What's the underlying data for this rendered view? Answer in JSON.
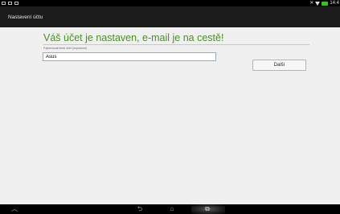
{
  "status_bar": {
    "time": "14:4"
  },
  "action_bar": {
    "title": "Nastavení účtu"
  },
  "form": {
    "headline": "Váš účet je nastaven, e-mail je na cestě!",
    "name_label": "Pojmenovat tento účet (nepovinné)",
    "name_value": "Asus",
    "next_label": "Další"
  },
  "navigation": {
    "up_glyph": "︿",
    "back_glyph": "⮌",
    "home_glyph": "⌂",
    "recents_glyph": "⧉"
  }
}
